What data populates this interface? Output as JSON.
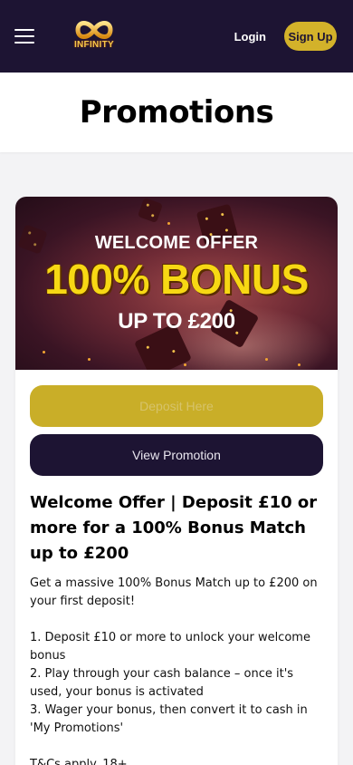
{
  "header": {
    "logo_text": "INFINITY",
    "login_label": "Login",
    "signup_label": "Sign Up"
  },
  "page": {
    "title": "Promotions"
  },
  "promo": {
    "banner": {
      "line1": "WELCOME OFFER",
      "line2": "100% BONUS",
      "line3": "UP TO £200"
    },
    "deposit_label": "Deposit Here",
    "view_label": "View Promotion",
    "heading": "Welcome Offer | Deposit £10 or more for a 100% Bonus Match up to £200",
    "intro": "Get a massive 100% Bonus Match up to £200 on your first deposit!",
    "steps": [
      "1. Deposit £10 or more to unlock your welcome bonus",
      "2. Play through your cash balance – once it's used, your bonus is activated",
      "3. Wager your bonus, then convert it to cash in 'My Promotions'"
    ],
    "tc": "T&Cs apply. 18+."
  },
  "colors": {
    "header_bg": "#1d1433",
    "accent_gold": "#d3b22a",
    "bonus_yellow": "#f7d814"
  },
  "icons": {
    "menu": "hamburger-menu-icon",
    "logo": "infinity-logo-icon"
  }
}
